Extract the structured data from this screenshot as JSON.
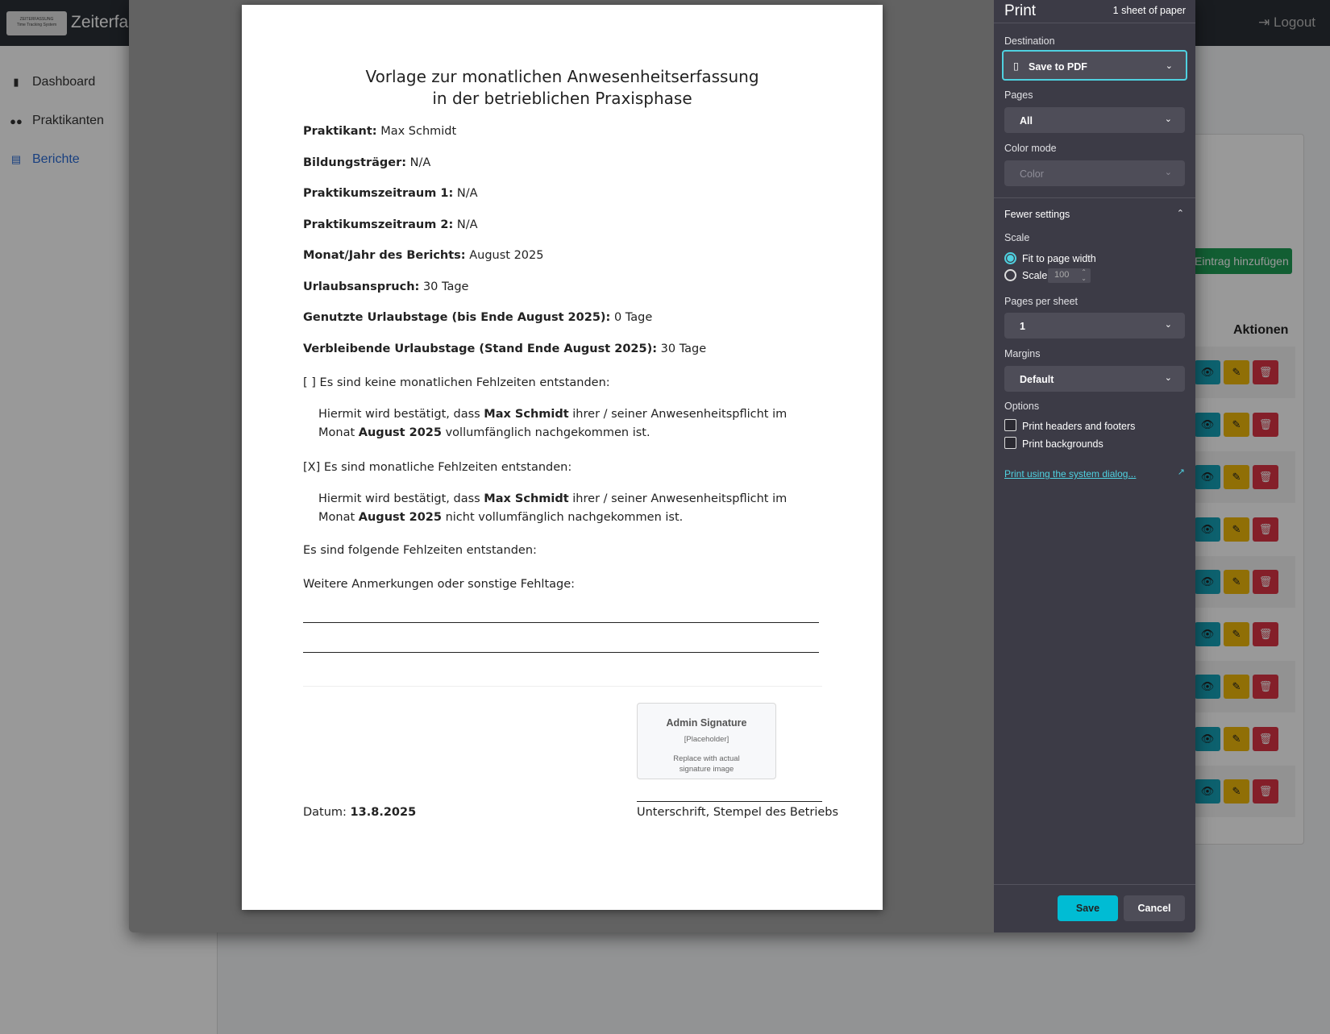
{
  "app": {
    "logo_text": "ZEITERFASSUNG",
    "logo_sub": "Time Tracking System",
    "title": "Zeiterfassung",
    "logout": "Logout"
  },
  "sidebar": {
    "items": [
      {
        "label": "Dashboard",
        "icon": "bar-chart-icon"
      },
      {
        "label": "Praktikanten",
        "icon": "users-icon"
      },
      {
        "label": "Berichte",
        "icon": "document-icon"
      }
    ]
  },
  "main": {
    "add_button": "Eintrag hinzufügen",
    "actions_header": "Aktionen",
    "row_count": 9
  },
  "document": {
    "title_line1": "Vorlage zur monatlichen Anwesenheitserfassung",
    "title_line2": "in der betrieblichen Praxisphase",
    "fields": [
      {
        "label": "Praktikant:",
        "value": "Max Schmidt"
      },
      {
        "label": "Bildungsträger:",
        "value": "N/A"
      },
      {
        "label": "Praktikumszeitraum 1:",
        "value": "N/A"
      },
      {
        "label": "Praktikumszeitraum 2:",
        "value": "N/A"
      },
      {
        "label": "Monat/Jahr des Berichts:",
        "value": "August 2025"
      },
      {
        "label": "Urlaubsanspruch:",
        "value": "30 Tage"
      },
      {
        "label": "Genutzte Urlaubstage (bis Ende August 2025):",
        "value": "0 Tage"
      },
      {
        "label": "Verbleibende Urlaubstage (Stand Ende August 2025):",
        "value": "30 Tage"
      }
    ],
    "option1": "[ ] Es sind keine monatlichen Fehlzeiten entstanden:",
    "option1_text_a": "Hiermit wird bestätigt, dass ",
    "option1_name": "Max Schmidt",
    "option1_text_b": " ihrer / seiner Anwesenheitspflicht im Monat ",
    "option1_month": "August 2025",
    "option1_text_c": " vollumfänglich nachgekommen ist.",
    "option2": "[X] Es sind monatliche Fehlzeiten entstanden:",
    "option2_text_a": "Hiermit wird bestätigt, dass ",
    "option2_name": "Max Schmidt",
    "option2_text_b": " ihrer / seiner Anwesenheitspflicht im Monat ",
    "option2_month": "August 2025",
    "option2_text_c": " nicht vollumfänglich nachgekommen ist.",
    "absences": "Es sind folgende Fehlzeiten entstanden:",
    "remarks": "Weitere Anmerkungen oder sonstige Fehltage:",
    "signature_title": "Admin Signature",
    "signature_placeholder": "[Placeholder]",
    "signature_note": "Replace with actual signature image",
    "date_label": "Datum:",
    "date_value": "13.8.2025",
    "signature_caption": "Unterschrift, Stempel des Betriebs"
  },
  "print_panel": {
    "title": "Print",
    "sheets": "1 sheet of paper",
    "destination_label": "Destination",
    "destination_value": "Save to PDF",
    "pages_label": "Pages",
    "pages_value": "All",
    "color_label": "Color mode",
    "color_value": "Color",
    "fewer_settings": "Fewer settings",
    "scale_label": "Scale",
    "fit_option": "Fit to page width",
    "scale_option": "Scale",
    "scale_value": "100",
    "pps_label": "Pages per sheet",
    "pps_value": "1",
    "margins_label": "Margins",
    "margins_value": "Default",
    "options_label": "Options",
    "opt_headers": "Print headers and footers",
    "opt_backgrounds": "Print backgrounds",
    "system_dialog": "Print using the system dialog...",
    "save": "Save",
    "cancel": "Cancel"
  },
  "colors": {
    "accent": "#00bcd4",
    "panel_bg": "#3c3b46",
    "view_btn": "#17a2b8",
    "edit_btn": "#f0b90b",
    "delete_btn": "#dc3545",
    "add_btn": "#1f9d55"
  }
}
